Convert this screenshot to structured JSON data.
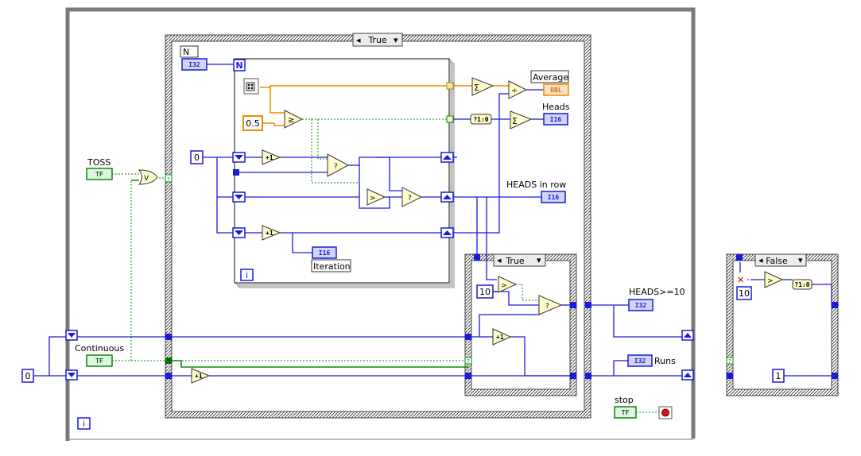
{
  "outer_loop": {
    "iteration_label": "i"
  },
  "outer_case": {
    "selector": "True"
  },
  "for_loop": {
    "count_terminal": "N",
    "iteration_label": "i"
  },
  "inner_case": {
    "selector": "True"
  },
  "false_case": {
    "selector": "False"
  },
  "controls": {
    "n": {
      "label": "N",
      "type": "I32"
    },
    "toss": {
      "label": "TOSS",
      "type": "TF"
    },
    "continuous": {
      "label": "Continuous",
      "type": "TF"
    },
    "stop": {
      "label": "stop",
      "type": "TF"
    }
  },
  "indicators": {
    "average": {
      "label": "Average",
      "type": "DBL"
    },
    "heads": {
      "label": "Heads",
      "type": "I16"
    },
    "heads_in_row": {
      "label": "HEADS in row",
      "type": "I16"
    },
    "iteration": {
      "label": "Iteration",
      "type": "I16"
    },
    "heads_ge_10": {
      "label": "HEADS>=10",
      "type": "I32"
    },
    "runs": {
      "label": "Runs",
      "type": "I32"
    }
  },
  "constants": {
    "init_zero": "0",
    "counter_zero": "0",
    "threshold_half": "0.5",
    "ten_a": "10",
    "ten_b": "10",
    "one": "1"
  },
  "node_glyphs": {
    "increment": "+1",
    "bool_to_int": "?1:0",
    "select": "?",
    "or_gate": "V",
    "sum": "Σ",
    "divide": "÷",
    "greater": ">",
    "greater_equal": "≥"
  },
  "colors": {
    "int_wire": "#1a1ad8",
    "bool_wire": "#0a8a0a",
    "dbl_wire": "#f08a00",
    "case_frame": "#404040",
    "while_frame": "#7a7a7a"
  }
}
